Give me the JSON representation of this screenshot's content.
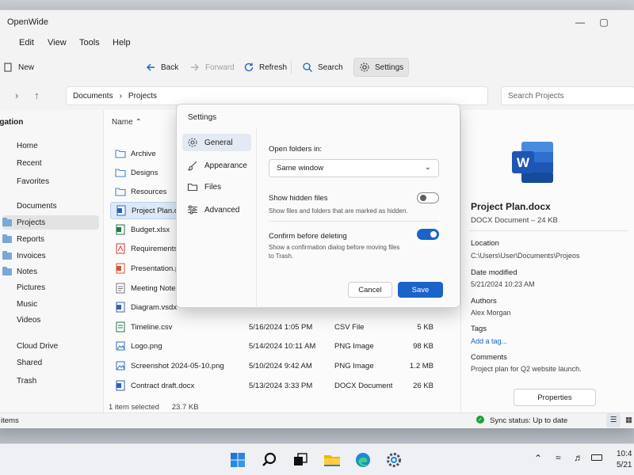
{
  "window": {
    "title": "OpenWide"
  },
  "menu": [
    "Edit",
    "View",
    "Tools",
    "Help"
  ],
  "toolbar": {
    "new": "New",
    "back": "Back",
    "forward": "Forward",
    "refresh": "Refresh",
    "search": "Search",
    "settings": "Settings"
  },
  "address": {
    "crumbs": [
      "Documents",
      "Projects"
    ],
    "search_placeholder": "Search Projects"
  },
  "nav": {
    "heading": "vigation",
    "items": [
      "Home",
      "Recent",
      "Favorites",
      "Documents",
      "Projects",
      "Reports",
      "Invoices",
      "Notes",
      "Pictures",
      "Music",
      "Videos",
      "Cloud Drive",
      "Shared",
      "Trash"
    ]
  },
  "files": {
    "column_name": "Name",
    "rows": [
      {
        "name": "Archive",
        "date": "",
        "type": "",
        "size": ""
      },
      {
        "name": "Designs",
        "date": "",
        "type": "",
        "size": ""
      },
      {
        "name": "Resources",
        "date": "",
        "type": "",
        "size": ""
      },
      {
        "name": "Project Plan.docx",
        "date": "",
        "type": "",
        "size": ""
      },
      {
        "name": "Budget.xlsx",
        "date": "",
        "type": "",
        "size": ""
      },
      {
        "name": "Requirements.pdf",
        "date": "",
        "type": "",
        "size": ""
      },
      {
        "name": "Presentation.pptx",
        "date": "",
        "type": "",
        "size": ""
      },
      {
        "name": "Meeting Notes.txt",
        "date": "",
        "type": "",
        "size": ""
      },
      {
        "name": "Diagram.vsdx",
        "date": "",
        "type": "",
        "size": ""
      },
      {
        "name": "Timeline.csv",
        "date": "5/16/2024 1:05 PM",
        "type": "CSV File",
        "size": "5 KB"
      },
      {
        "name": "Logo.png",
        "date": "5/14/2024 10:11 AM",
        "type": "PNG Image",
        "size": "98 KB"
      },
      {
        "name": "Screenshot 2024-05-10.png",
        "date": "5/10/2024 9:42 AM",
        "type": "PNG Image",
        "size": "1.2 MB"
      },
      {
        "name": "Contract draft.docx",
        "date": "5/13/2024 3:33 PM",
        "type": "DOCX Document",
        "size": "26 KB"
      }
    ],
    "selection": "1 item selected",
    "selection_size": "23.7 KB"
  },
  "details": {
    "file_name": "Project Plan.docx",
    "file_meta": "DOCX Document – 24 KB",
    "location_label": "Location",
    "location": "C:\\Users\\User\\Documents\\Projeos",
    "modified_label": "Date modified",
    "modified": "5/21/2024 10:23 AM",
    "authors_label": "Authors",
    "authors": "Alex Morgan",
    "tags_label": "Tags",
    "tags_action": "Add a tag...",
    "comments_label": "Comments",
    "comments": "Project plan for Q2 website launch.",
    "properties": "Properties"
  },
  "status": {
    "items": "items",
    "sync": "Sync status: Up to date"
  },
  "dialog": {
    "title": "Settings",
    "nav": [
      "General",
      "Appearance",
      "Files",
      "Advanced"
    ],
    "open_folders_label": "Open folders in:",
    "open_folders_value": "Same window",
    "hidden_label": "Show hidden files",
    "hidden_desc": "Show files and folders that are marked as hidden.",
    "hidden_on": false,
    "confirm_label": "Confirm before deleting",
    "confirm_desc": "Show a confirmation dialog before moving files to Trash.",
    "confirm_on": true,
    "cancel": "Cancel",
    "save": "Save"
  },
  "taskbar": {
    "time": "10:4",
    "date": "5/21"
  },
  "colors": {
    "accent": "#1a63c9",
    "word": "#2b5fb8",
    "excel": "#1f7a43",
    "pdf": "#d23a2e",
    "ppt": "#d2542e"
  }
}
